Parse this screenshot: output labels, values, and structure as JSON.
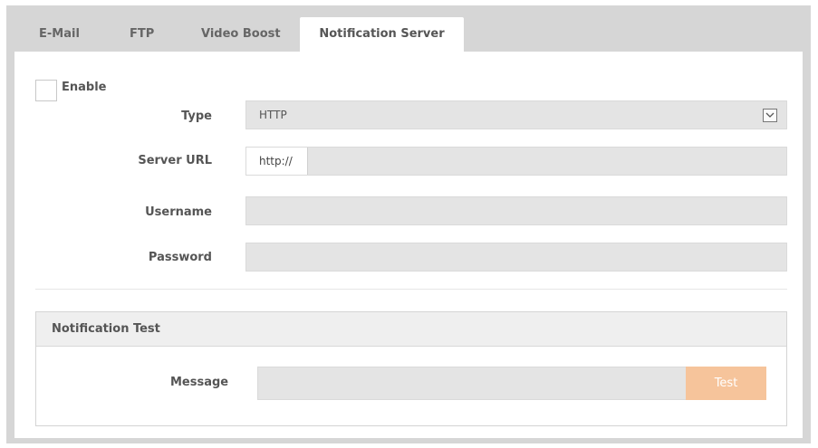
{
  "tabs": [
    {
      "label": "E-Mail",
      "active": false
    },
    {
      "label": "FTP",
      "active": false
    },
    {
      "label": "Video Boost",
      "active": false
    },
    {
      "label": "Notification Server",
      "active": true
    }
  ],
  "enable": {
    "label": "Enable",
    "checked": false
  },
  "form": {
    "type": {
      "label": "Type",
      "value": "HTTP"
    },
    "server_url": {
      "label": "Server URL",
      "prefix": "http://",
      "value": ""
    },
    "username": {
      "label": "Username",
      "value": ""
    },
    "password": {
      "label": "Password",
      "value": ""
    }
  },
  "notification_test": {
    "title": "Notification Test",
    "message_label": "Message",
    "message_value": "",
    "test_button": "Test"
  },
  "colors": {
    "frame_bg": "#d6d6d6",
    "input_bg": "#e4e4e4",
    "test_button_bg": "#f6c49b"
  },
  "icons": {
    "select_arrow": "chevron-down-icon"
  }
}
